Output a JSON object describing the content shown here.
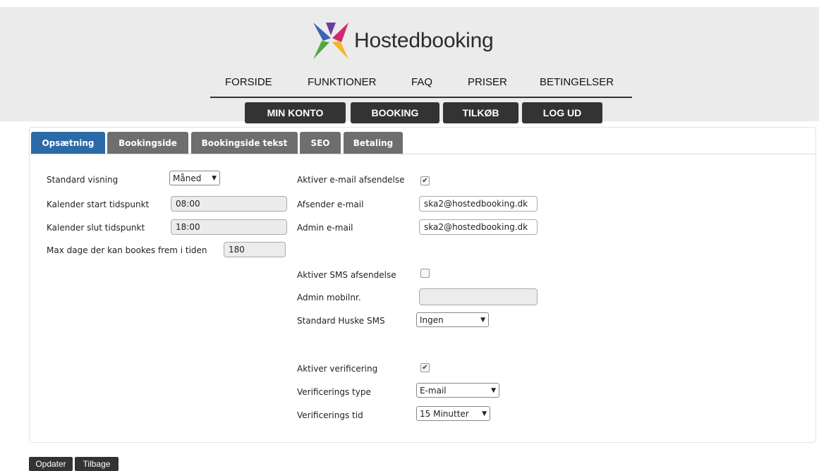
{
  "brand": {
    "name": "Hostedbooking"
  },
  "topnav": [
    "FORSIDE",
    "FUNKTIONER",
    "FAQ",
    "PRISER",
    "BETINGELSER"
  ],
  "account_nav": [
    "MIN KONTO",
    "BOOKING",
    "TILKØB",
    "LOG UD"
  ],
  "tabs": [
    "Opsætning",
    "Bookingside",
    "Bookingside tekst",
    "SEO",
    "Betaling"
  ],
  "left": {
    "standard_visning_label": "Standard visning",
    "standard_visning_value": "Måned",
    "kal_start_label": "Kalender start tidspunkt",
    "kal_start_value": "08:00",
    "kal_slut_label": "Kalender slut tidspunkt",
    "kal_slut_value": "18:00",
    "max_dage_label": "Max dage der kan bookes frem i tiden",
    "max_dage_value": "180"
  },
  "right": {
    "email_enable_label": "Aktiver e-mail afsendelse",
    "email_enable_checked": true,
    "sender_email_label": "Afsender e-mail",
    "sender_email_value": "ska2@hostedbooking.dk",
    "admin_email_label": "Admin e-mail",
    "admin_email_value": "ska2@hostedbooking.dk",
    "sms_enable_label": "Aktiver SMS afsendelse",
    "sms_enable_checked": false,
    "admin_mobile_label": "Admin mobilnr.",
    "admin_mobile_value": "",
    "reminder_sms_label": "Standard Huske SMS",
    "reminder_sms_value": "Ingen",
    "verify_enable_label": "Aktiver verificering",
    "verify_enable_checked": true,
    "verify_type_label": "Verificerings type",
    "verify_type_value": "E-mail",
    "verify_time_label": "Verificerings tid",
    "verify_time_value": "15 Minutter"
  },
  "footer_buttons": [
    "Opdater",
    "Tilbage"
  ],
  "colors": {
    "active_tab": "#2b6aa6",
    "tab": "#6e6e6e",
    "nav_button": "#333333",
    "header_bg": "#ebebeb"
  }
}
